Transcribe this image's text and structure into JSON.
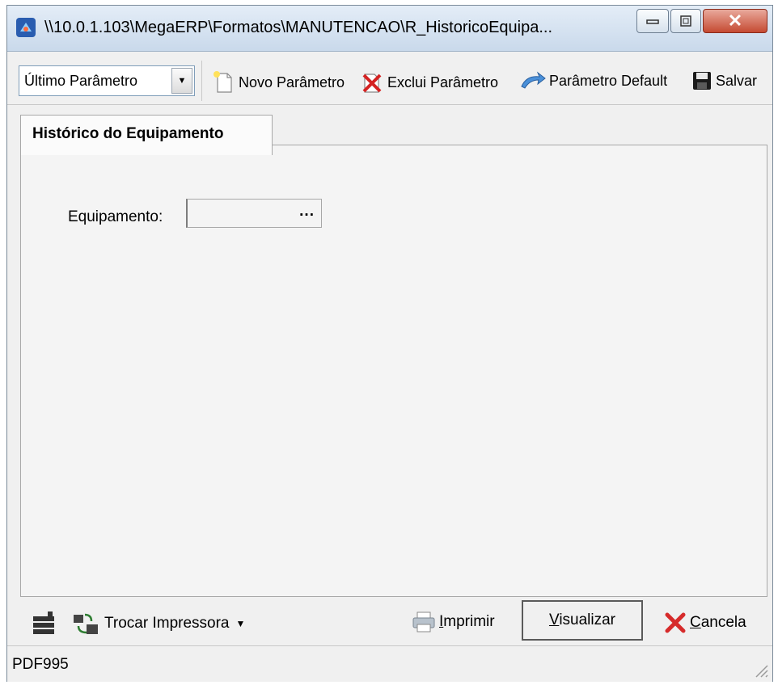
{
  "window": {
    "title": "\\\\10.0.1.103\\MegaERP\\Formatos\\MANUTENCAO\\R_HistoricoEquipa..."
  },
  "toolbar": {
    "parameter_select": "Último Parâmetro",
    "new_label": "Novo Parâmetro",
    "delete_label": "Exclui Parâmetro",
    "default_label": "Parâmetro Default",
    "save_label": "Salvar"
  },
  "tabs": [
    {
      "label": "Histórico do Equipamento"
    }
  ],
  "form": {
    "equipment_label": "Equipamento:",
    "equipment_value": "",
    "lookup_button": "..."
  },
  "bottom": {
    "change_printer_label": "Trocar Impressora",
    "print_mnemonic": "I",
    "print_rest": "mprimir",
    "preview_mnemonic": "V",
    "preview_rest": "isualizar",
    "cancel_mnemonic": "C",
    "cancel_rest": "ancela"
  },
  "status": {
    "printer_name": "PDF995"
  },
  "colors": {
    "close_button": "#c54a32",
    "titlebar": "#c9d9eb",
    "panel": "#f4f4f4"
  }
}
